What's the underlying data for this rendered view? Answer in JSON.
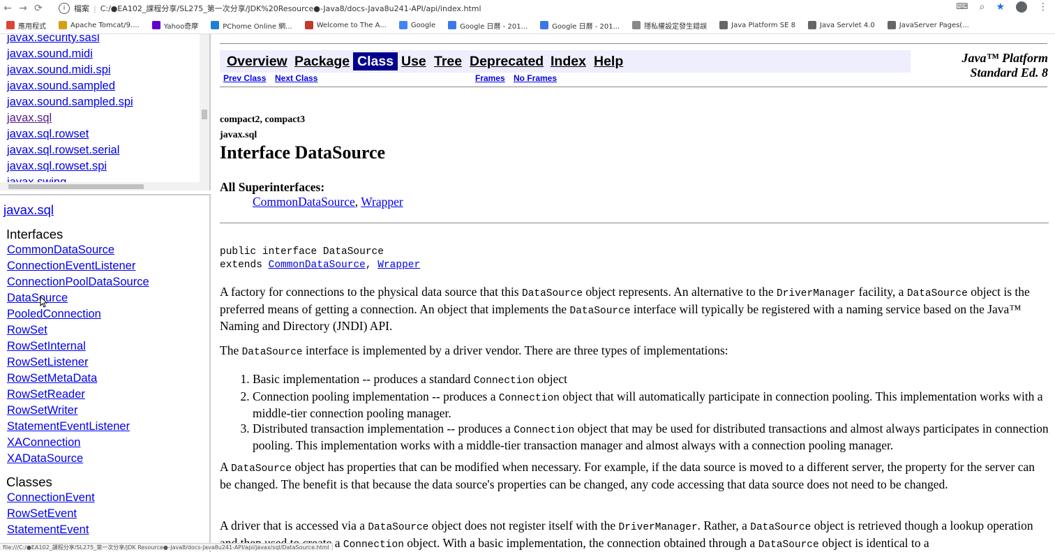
{
  "browser": {
    "back": "←",
    "forward": "→",
    "reload": "⟳",
    "security_label": "檔案",
    "url": "C:/●EA102_課程分享/SL275_第一次分享/JDK%20Resource●-Java8/docs-Java8u241-API/api/index.html",
    "bookmarks": [
      {
        "label": "應用程式",
        "color": "#db4437"
      },
      {
        "label": "Apache Tomcat/9....",
        "color": "#d4a017"
      },
      {
        "label": "Yahoo奇摩",
        "color": "#6001d2"
      },
      {
        "label": "PChome Online 網...",
        "color": "#1e7fd6"
      },
      {
        "label": "Welcome to The A...",
        "color": "#c0392b"
      },
      {
        "label": "Google",
        "color": "#4285f4"
      },
      {
        "label": "Google 日曆 - 201...",
        "color": "#3b78e7"
      },
      {
        "label": "Google 日曆 - 201...",
        "color": "#3b78e7"
      },
      {
        "label": "隱私權設定發生錯誤",
        "color": "#888888"
      },
      {
        "label": "Java Platform SE 8",
        "color": "#666666"
      },
      {
        "label": "Java Servlet 4.0",
        "color": "#666666"
      },
      {
        "label": "JavaServer Pages(...",
        "color": "#666666"
      }
    ]
  },
  "package_list": [
    {
      "label": "javax.security.sasl",
      "visited": false
    },
    {
      "label": "javax.sound.midi",
      "visited": false
    },
    {
      "label": "javax.sound.midi.spi",
      "visited": false
    },
    {
      "label": "javax.sound.sampled",
      "visited": false
    },
    {
      "label": "javax.sound.sampled.spi",
      "visited": false
    },
    {
      "label": "javax.sql",
      "visited": true
    },
    {
      "label": "javax.sql.rowset",
      "visited": false
    },
    {
      "label": "javax.sql.rowset.serial",
      "visited": false
    },
    {
      "label": "javax.sql.rowset.spi",
      "visited": false
    },
    {
      "label": "javax.swing",
      "visited": false
    }
  ],
  "package_frame": {
    "title": "javax.sql",
    "interfaces_heading": "Interfaces",
    "interfaces": [
      "CommonDataSource",
      "ConnectionEventListener",
      "ConnectionPoolDataSource",
      "DataSource",
      "PooledConnection",
      "RowSet",
      "RowSetInternal",
      "RowSetListener",
      "RowSetMetaData",
      "RowSetReader",
      "RowSetWriter",
      "StatementEventListener",
      "XAConnection",
      "XADataSource"
    ],
    "classes_heading": "Classes",
    "classes": [
      "ConnectionEvent",
      "RowSetEvent",
      "StatementEvent"
    ]
  },
  "navbar": {
    "overview": "Overview",
    "package": "Package",
    "class": "Class",
    "use": "Use",
    "tree": "Tree",
    "deprecated": "Deprecated",
    "index": "Index",
    "help": "Help",
    "prev_class": "Prev Class",
    "next_class": "Next Class",
    "frames": "Frames",
    "no_frames": "No Frames",
    "platform_line1": "Java™ Platform",
    "platform_line2": "Standard Ed. 8"
  },
  "doc": {
    "profiles": "compact2, compact3",
    "package": "javax.sql",
    "title": "Interface DataSource",
    "superinterfaces_label": "All Superinterfaces:",
    "superinterface_1": "CommonDataSource",
    "superinterface_sep": ", ",
    "superinterface_2": "Wrapper",
    "signature_line1": "public interface DataSource",
    "signature_extends": "extends ",
    "signature_comma": ", ",
    "p1_a": "A factory for connections to the physical data source that this ",
    "p1_b": " object represents. An alternative to the ",
    "p1_c": " facility, a ",
    "p1_d": " object is the preferred means of getting a connection. An object that implements the ",
    "p1_e": " interface will typically be registered with a naming service based on the Java™ Naming and Directory (JNDI) API.",
    "code_datasource": "DataSource",
    "code_drivermanager": "DriverManager",
    "code_connection": "Connection",
    "p2_a": "The ",
    "p2_b": " interface is implemented by a driver vendor. There are three types of implementations:",
    "li1_a": "Basic implementation -- produces a standard ",
    "li1_b": " object",
    "li2_a": "Connection pooling implementation -- produces a ",
    "li2_b": " object that will automatically participate in connection pooling. This implementation works with a middle-tier connection pooling manager.",
    "li3_a": "Distributed transaction implementation -- produces a ",
    "li3_b": " object that may be used for distributed transactions and almost always participates in connection pooling. This implementation works with a middle-tier transaction manager and almost always with a connection pooling manager.",
    "p3_a": "A ",
    "p3_b": " object has properties that can be modified when necessary. For example, if the data source is moved to a different server, the property for the server can be changed. The benefit is that because the data source's properties can be changed, any code accessing that data source does not need to be changed.",
    "p4_a": "A driver that is accessed via a ",
    "p4_b": " object does not register itself with the ",
    "p4_c": ". Rather, a ",
    "p4_d": " object is retrieved though a lookup operation and then used to create a ",
    "p4_e": " object. With a basic implementation, the connection obtained through a ",
    "p4_f": " object is identical to a"
  },
  "status_bar": "file:///C:/●EA102_課程分享/SL275_第一次分享/JDK Resource●-Java8/docs-Java8u241-API/api/javax/sql/DataSource.html"
}
